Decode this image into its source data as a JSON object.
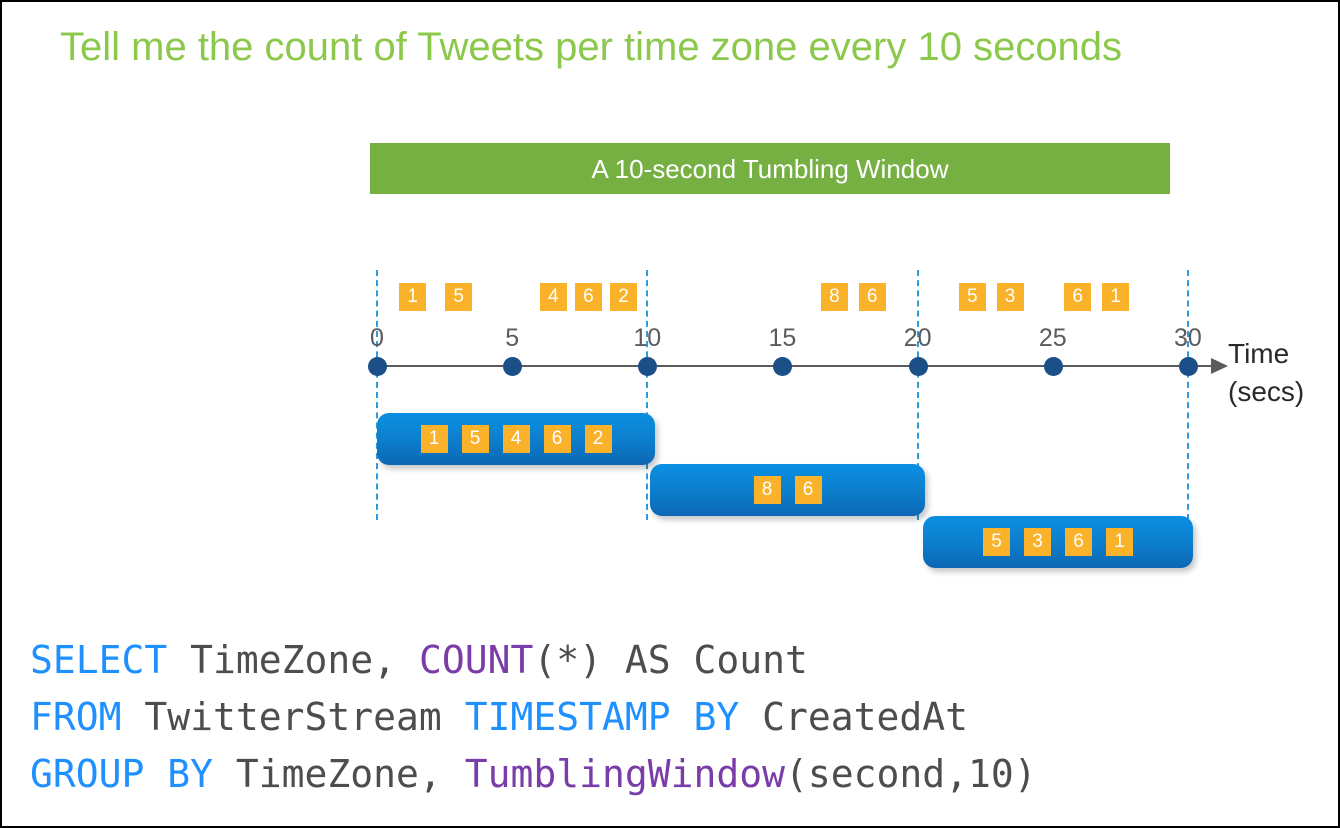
{
  "slide": {
    "title": "Tell me the count of Tweets per time zone every 10 seconds",
    "title_color": "#8CC84B",
    "background": "#ffffff"
  },
  "window_banner": {
    "label": "A 10-second Tumbling Window",
    "color": "#76B043",
    "text_color": "#ffffff"
  },
  "timeline": {
    "axis_label": "Time",
    "axis_unit": "(secs)",
    "tick_labels": [
      "0",
      "5",
      "10",
      "15",
      "20",
      "25",
      "30"
    ],
    "tick_values": [
      0,
      5,
      10,
      15,
      20,
      25,
      30
    ],
    "boundaries": [
      0,
      10,
      20,
      30
    ],
    "dot_color": "#1B4F87",
    "axis_color": "#5B5B5B",
    "boundary_color": "#2E9BE0",
    "events": [
      {
        "value": "1",
        "time": 0.6
      },
      {
        "value": "5",
        "time": 2.3
      },
      {
        "value": "4",
        "time": 5.8
      },
      {
        "value": "6",
        "time": 7.1
      },
      {
        "value": "2",
        "time": 8.4
      },
      {
        "value": "8",
        "time": 16.2
      },
      {
        "value": "6",
        "time": 17.6
      },
      {
        "value": "5",
        "time": 21.3
      },
      {
        "value": "3",
        "time": 22.7
      },
      {
        "value": "6",
        "time": 25.2
      },
      {
        "value": "1",
        "time": 26.6
      }
    ]
  },
  "windows": [
    {
      "name": "window-0-10",
      "range": "0-10",
      "values": [
        "1",
        "5",
        "4",
        "6",
        "2"
      ]
    },
    {
      "name": "window-10-20",
      "range": "10-20",
      "values": [
        "8",
        "6"
      ]
    },
    {
      "name": "window-20-30",
      "range": "20-30",
      "values": [
        "5",
        "3",
        "6",
        "1"
      ]
    }
  ],
  "sql": {
    "lines": [
      [
        {
          "t": "SELECT",
          "c": "kw-blue"
        },
        {
          "t": " TimeZone, ",
          "c": "kw-plain"
        },
        {
          "t": "COUNT",
          "c": "kw-purple"
        },
        {
          "t": "(*) AS Count",
          "c": "kw-plain"
        }
      ],
      [
        {
          "t": "FROM",
          "c": "kw-blue"
        },
        {
          "t": " TwitterStream ",
          "c": "kw-plain"
        },
        {
          "t": "TIMESTAMP BY",
          "c": "kw-blue"
        },
        {
          "t": " CreatedAt",
          "c": "kw-plain"
        }
      ],
      [
        {
          "t": "GROUP BY",
          "c": "kw-blue"
        },
        {
          "t": " TimeZone, ",
          "c": "kw-plain"
        },
        {
          "t": "TumblingWindow",
          "c": "kw-purple"
        },
        {
          "t": "(second,10)",
          "c": "kw-plain"
        }
      ]
    ],
    "keyword_color": "#1E90FF",
    "function_color": "#7A3CA8",
    "text_color": "#4D4D4D"
  }
}
